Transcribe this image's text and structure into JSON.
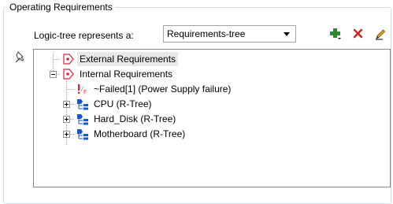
{
  "group": {
    "title": "Operating Requirements"
  },
  "logic_tree": {
    "label": "Logic-tree represents a:",
    "selected": "Requirements-tree"
  },
  "toolbar": {
    "add_icon": "green-plus-dropdown-icon",
    "delete_icon": "red-x-icon",
    "edit_icon": "pencil-icon"
  },
  "side": {
    "pin_icon": "pushpin-icon"
  },
  "tree": {
    "nodes": [
      {
        "label": "External Requirements",
        "icon": "requirement-icon",
        "expander": "none",
        "selected": true
      },
      {
        "label": "Internal Requirements",
        "icon": "requirement-icon",
        "expander": "expanded",
        "selected": false
      },
      {
        "label": "~Failed[1]  (Power Supply failure)",
        "icon": "failure-icon",
        "expander": "none",
        "selected": false
      },
      {
        "label": "CPU (R-Tree)",
        "icon": "r-tree-icon",
        "expander": "collapsed",
        "selected": false
      },
      {
        "label": "Hard_Disk (R-Tree)",
        "icon": "r-tree-icon",
        "expander": "collapsed",
        "selected": false
      },
      {
        "label": "Motherboard (R-Tree)",
        "icon": "r-tree-icon",
        "expander": "collapsed",
        "selected": false
      }
    ]
  },
  "colors": {
    "requirement_icon": "#d7263d",
    "r_tree_icon": "#1a56c8",
    "failure_icon": "#d7263d",
    "add_icon": "#2e8b2e",
    "delete_icon": "#cc2222"
  }
}
